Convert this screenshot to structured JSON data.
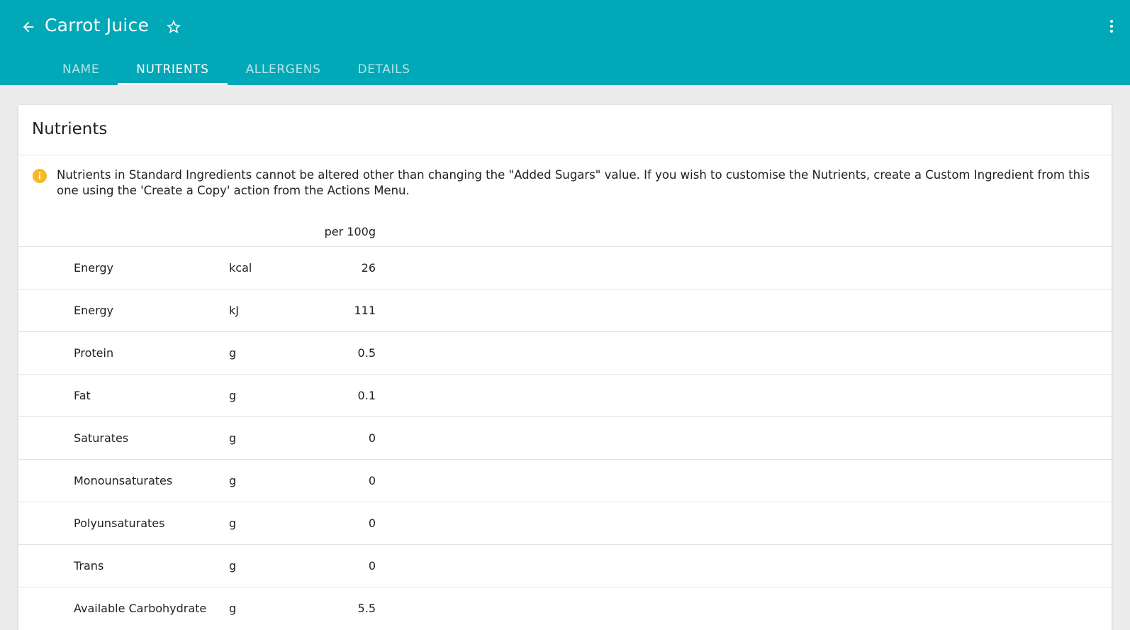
{
  "header": {
    "title": "Carrot Juice",
    "back_icon": "arrow-left-icon",
    "favorite_icon": "star-outline-icon",
    "more_icon": "more-vertical-icon"
  },
  "tabs": [
    {
      "label": "NAME",
      "active": false
    },
    {
      "label": "NUTRIENTS",
      "active": true
    },
    {
      "label": "ALLERGENS",
      "active": false
    },
    {
      "label": "DETAILS",
      "active": false
    }
  ],
  "card": {
    "title": "Nutrients",
    "notice": "Nutrients in Standard Ingredients cannot be altered other than changing the \"Added Sugars\" value. If you wish to customise the Nutrients, create a Custom Ingredient from this one using the 'Create a Copy' action from the Actions Menu.",
    "notice_icon": "info-icon",
    "column_header": "per 100g"
  },
  "nutrients": [
    {
      "name": "Energy",
      "unit": "kcal",
      "value": "26"
    },
    {
      "name": "Energy",
      "unit": "kJ",
      "value": "111"
    },
    {
      "name": "Protein",
      "unit": "g",
      "value": "0.5"
    },
    {
      "name": "Fat",
      "unit": "g",
      "value": "0.1"
    },
    {
      "name": "Saturates",
      "unit": "g",
      "value": "0"
    },
    {
      "name": "Monounsaturates",
      "unit": "g",
      "value": "0"
    },
    {
      "name": "Polyunsaturates",
      "unit": "g",
      "value": "0"
    },
    {
      "name": "Trans",
      "unit": "g",
      "value": "0"
    },
    {
      "name": "Available Carbohydrate",
      "unit": "g",
      "value": "5.5"
    }
  ],
  "colors": {
    "primary": "#00a8b8",
    "warning": "#f7b928",
    "background": "#ececec"
  }
}
